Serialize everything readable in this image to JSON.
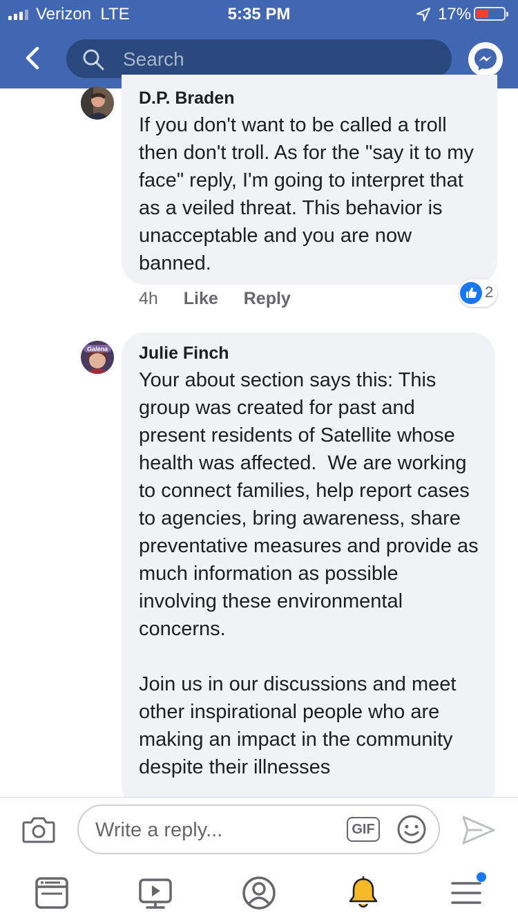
{
  "status_bar": {
    "carrier": "Verizon",
    "network": "LTE",
    "time": "5:35 PM",
    "battery_percent": "17%",
    "battery_level": 0.17,
    "battery_color": "#ff3b30"
  },
  "header": {
    "background": "#4267b2",
    "back_icon": "chevron-left-icon",
    "search_placeholder": "Search",
    "messenger_icon": "messenger-icon"
  },
  "comments": [
    {
      "author": "D.P. Braden",
      "text": "If you don't want to be called a troll then don't troll. As for the \"say it to my face\" reply, I'm going to interpret that as a veiled threat. This behavior is unacceptable and you are now banned.",
      "time": "4h",
      "like_label": "Like",
      "reply_label": "Reply",
      "reaction_count": "2",
      "reaction_icon": "like-reaction-icon"
    },
    {
      "author": "Julie Finch",
      "avatar_text": "Galena",
      "text": "Your about section says this: This group was created for past and present residents of Satellite whose health was affected.  We are working to connect families, help report cases to agencies, bring awareness, share preventative measures and provide as much information as possible involving these environmental concerns.\n\nJoin us in our discussions and meet other inspirational people who are making an impact in the community despite their illnesses"
    }
  ],
  "composer": {
    "camera_icon": "camera-icon",
    "placeholder": "Write a reply...",
    "gif_label": "GIF",
    "emoji_icon": "emoji-icon",
    "send_icon": "send-icon"
  },
  "tab_bar": {
    "tabs": [
      "news-feed-icon",
      "watch-icon",
      "profile-icon",
      "notifications-icon",
      "menu-icon"
    ],
    "active_color": "#f7b928",
    "badge_color": "#1877f2"
  }
}
